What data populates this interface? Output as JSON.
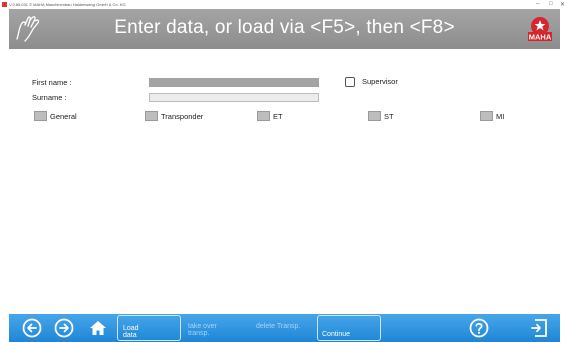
{
  "window": {
    "title": "V.9.85.031 © MAHA Maschinenbau Haldenwang GmbH & Co. KG",
    "min_label": "–",
    "max_label": "□",
    "close_label": "✕"
  },
  "header": {
    "title": "Enter data, or load via <F5>, then <F8>",
    "logo_text": "MAHA",
    "colors": {
      "background": "#999999",
      "logo_red": "#d4262c"
    }
  },
  "form": {
    "first_name_label": "First name :",
    "surname_label": "Surname :",
    "first_name_value": "",
    "surname_value": "",
    "supervisor_label": "Supervisor",
    "supervisor_checked": false,
    "toggles": [
      {
        "label": "General"
      },
      {
        "label": "Transponder"
      },
      {
        "label": "ET"
      },
      {
        "label": "ST"
      },
      {
        "label": "MI"
      }
    ]
  },
  "footer": {
    "load_data_line1": "Load",
    "load_data_line2": "data",
    "take_over_line1": "take over",
    "take_over_line2": "transp.",
    "delete_transp": "delete Transp.",
    "continue": "Continue",
    "icons": [
      "back-arrow-icon",
      "forward-arrow-icon",
      "home-icon",
      "help-icon",
      "exit-icon"
    ],
    "colors": {
      "background": "#2b90dc",
      "disabled_text": "#a9d4f4"
    }
  }
}
